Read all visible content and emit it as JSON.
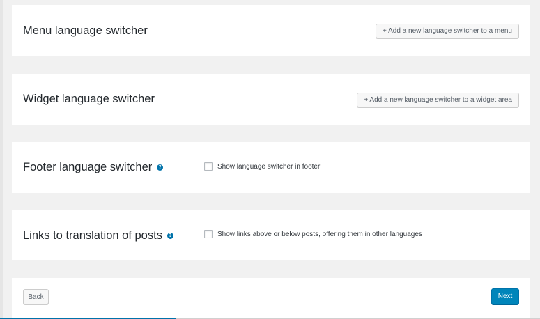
{
  "sections": {
    "menu": {
      "title": "Menu language switcher",
      "button_label": "+ Add a new language switcher to a menu"
    },
    "widget": {
      "title": "Widget language switcher",
      "button_label": "+ Add a new language switcher to a widget area"
    },
    "footer": {
      "title": "Footer language switcher",
      "help_icon": "question-circle-icon",
      "checkbox_label": "Show language switcher in footer",
      "checked": false
    },
    "links": {
      "title": "Links to translation of posts",
      "help_icon": "question-circle-icon",
      "checkbox_label": "Show links above or below posts, offering them in other languages",
      "checked": false
    }
  },
  "navigation": {
    "back_label": "Back",
    "next_label": "Next"
  },
  "colors": {
    "background": "#f1f1f1",
    "card": "#ffffff",
    "primary": "#0085ba",
    "help_icon": "#0073aa"
  }
}
